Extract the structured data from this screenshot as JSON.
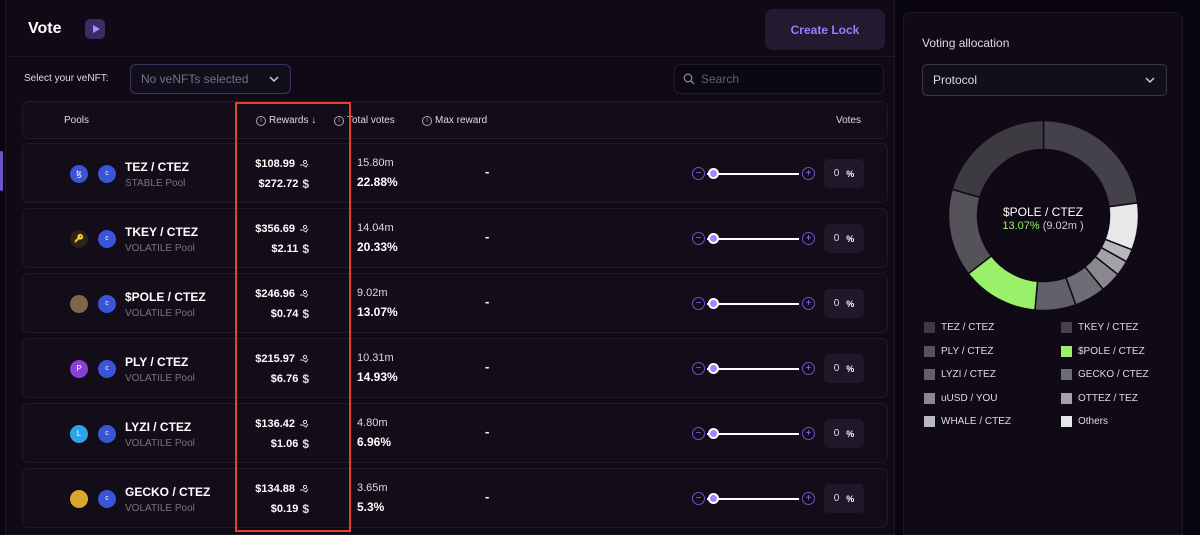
{
  "header": {
    "title": "Vote",
    "create_lock_label": "Create Lock"
  },
  "filters": {
    "venft_label": "Select your veNFT:",
    "venft_placeholder": "No veNFTs selected",
    "search_placeholder": "Search"
  },
  "columns": {
    "pools": "Pools",
    "rewards": "Rewards ↓",
    "total_votes": "Total votes",
    "max_reward": "Max reward",
    "votes": "Votes"
  },
  "rows": [
    {
      "name": "TEZ / CTEZ",
      "type": "STABLE Pool",
      "reward_top": "$108.99",
      "reward_bottom": "$272.72",
      "votes_amount": "15.80m",
      "votes_pct": "22.88%",
      "max_reward": "-",
      "vote_value": "0",
      "pct_symbol": "%",
      "token1_color": "#3a54d6",
      "token1_glyph": "ꜩ"
    },
    {
      "name": "TKEY / CTEZ",
      "type": "VOLATILE Pool",
      "reward_top": "$356.69",
      "reward_bottom": "$2.11",
      "votes_amount": "14.04m",
      "votes_pct": "20.33%",
      "max_reward": "-",
      "vote_value": "0",
      "pct_symbol": "%",
      "token1_color": "#2b2418",
      "token1_glyph": "🔑"
    },
    {
      "name": "$POLE / CTEZ",
      "type": "VOLATILE Pool",
      "reward_top": "$246.96",
      "reward_bottom": "$0.74",
      "votes_amount": "9.02m",
      "votes_pct": "13.07%",
      "max_reward": "-",
      "vote_value": "0",
      "pct_symbol": "%",
      "token1_color": "#7a6a4a",
      "token1_glyph": ""
    },
    {
      "name": "PLY / CTEZ",
      "type": "VOLATILE Pool",
      "reward_top": "$215.97",
      "reward_bottom": "$6.76",
      "votes_amount": "10.31m",
      "votes_pct": "14.93%",
      "max_reward": "-",
      "vote_value": "0",
      "pct_symbol": "%",
      "token1_color": "#8a3fd8",
      "token1_glyph": "P"
    },
    {
      "name": "LYZI / CTEZ",
      "type": "VOLATILE Pool",
      "reward_top": "$136.42",
      "reward_bottom": "$1.06",
      "votes_amount": "4.80m",
      "votes_pct": "6.96%",
      "max_reward": "-",
      "vote_value": "0",
      "pct_symbol": "%",
      "token1_color": "#2fa3e6",
      "token1_glyph": "L"
    },
    {
      "name": "GECKO / CTEZ",
      "type": "VOLATILE Pool",
      "reward_top": "$134.88",
      "reward_bottom": "$0.19",
      "votes_amount": "3.65m",
      "votes_pct": "5.3%",
      "max_reward": "-",
      "vote_value": "0",
      "pct_symbol": "%",
      "token1_color": "#d8a82c",
      "token1_glyph": ""
    }
  ],
  "token2_glyph": "c",
  "allocation": {
    "title": "Voting allocation",
    "selected": "Protocol",
    "center_name": "$POLE / CTEZ",
    "center_pct": "13.07%",
    "center_amount": "(9.02m )",
    "legend": [
      {
        "label": "TEZ / CTEZ",
        "color": "#3e3a42"
      },
      {
        "label": "TKEY / CTEZ",
        "color": "#45414a"
      },
      {
        "label": "PLY / CTEZ",
        "color": "#55525a"
      },
      {
        "label": "$POLE / CTEZ",
        "color": "#9bf06a"
      },
      {
        "label": "LYZI / CTEZ",
        "color": "#626068"
      },
      {
        "label": "GECKO / CTEZ",
        "color": "#6e6c74"
      },
      {
        "label": "uUSD / YOU",
        "color": "#8a888e"
      },
      {
        "label": "OTTEZ / TEZ",
        "color": "#a3a2a7"
      },
      {
        "label": "WHALE / CTEZ",
        "color": "#b8b7bb"
      },
      {
        "label": "Others",
        "color": "#e8e8ea"
      }
    ]
  },
  "chart_data": {
    "type": "pie",
    "categories": [
      "TKEY / CTEZ",
      "Others",
      "WHALE / CTEZ",
      "OTTEZ / TEZ",
      "uUSD / YOU",
      "GECKO / CTEZ",
      "LYZI / CTEZ",
      "$POLE / CTEZ",
      "PLY / CTEZ",
      "TEZ / CTEZ"
    ],
    "values": [
      22.88,
      8.0,
      2.2,
      2.6,
      3.5,
      5.3,
      6.96,
      13.07,
      14.93,
      20.56
    ],
    "colors": [
      "#45414a",
      "#e8e8ea",
      "#b8b7bb",
      "#a3a2a7",
      "#8a888e",
      "#6e6c74",
      "#626068",
      "#9bf06a",
      "#55525a",
      "#3e3a42"
    ]
  }
}
